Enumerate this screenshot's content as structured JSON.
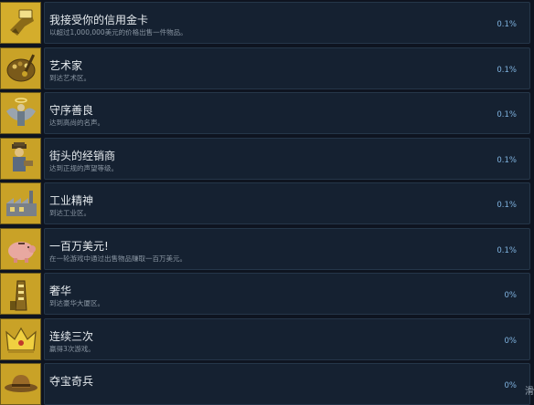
{
  "achievements": [
    {
      "title": "我接受你的信用金卡",
      "desc": "以超过1,000,000美元的价格出售一件物品。",
      "pct": "0.1%",
      "icon": "hand-card-icon"
    },
    {
      "title": "艺术家",
      "desc": "到达艺术区。",
      "pct": "0.1%",
      "icon": "palette-icon"
    },
    {
      "title": "守序善良",
      "desc": "达到高尚的名声。",
      "pct": "0.1%",
      "icon": "angel-icon"
    },
    {
      "title": "街头的经销商",
      "desc": "达到正规的声望等级。",
      "pct": "0.1%",
      "icon": "street-dealer-icon"
    },
    {
      "title": "工业精神",
      "desc": "到达工业区。",
      "pct": "0.1%",
      "icon": "factory-icon"
    },
    {
      "title": "一百万美元!",
      "desc": "在一轮游戏中通过出售物品赚取一百万美元。",
      "pct": "0.1%",
      "icon": "piggy-bank-icon"
    },
    {
      "title": "奢华",
      "desc": "到达豪华大厦区。",
      "pct": "0%",
      "icon": "tower-icon"
    },
    {
      "title": "连续三次",
      "desc": "赢得3次游戏。",
      "pct": "0%",
      "icon": "crown-icon"
    },
    {
      "title": "夺宝奇兵",
      "desc": "",
      "pct": "0%",
      "icon": "explorer-hat-icon"
    }
  ],
  "colors": {
    "background": "#0e1420",
    "card": "#152131",
    "icon_gold": "#c9a227",
    "percent_blue": "#7fb3e0"
  },
  "scroll_hint_glyph": "滑"
}
